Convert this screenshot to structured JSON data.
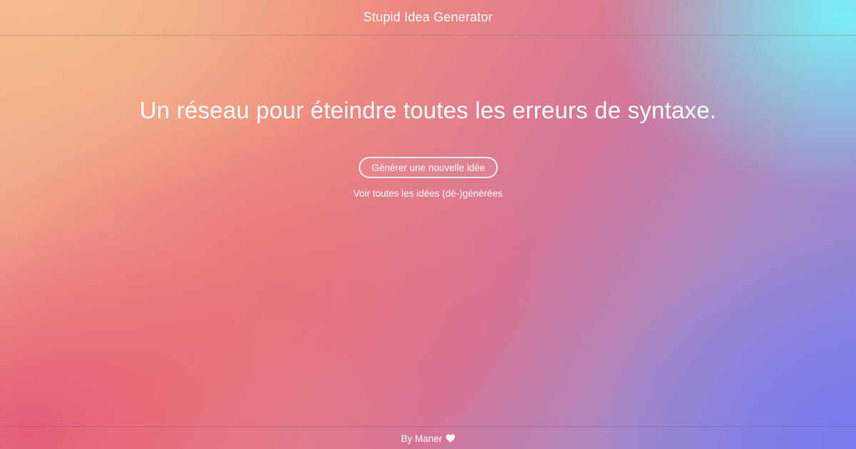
{
  "header": {
    "title": "Stupid Idea Generator"
  },
  "main": {
    "idea_text": "Un réseau pour éteindre toutes les erreurs de syntaxe.",
    "generate_button_label": "Générer une nouvelle idée",
    "all_ideas_link_label": "Voir toutes les idées (dé-)générées"
  },
  "footer": {
    "credit_text": "By Maner",
    "icon": "heart-icon"
  },
  "colors": {
    "text": "#ffffff",
    "gradient_top_left": "#f2b08e",
    "gradient_top_right": "#78f5fa",
    "gradient_bottom_left": "#e45276",
    "gradient_bottom_right": "#7678f0"
  }
}
